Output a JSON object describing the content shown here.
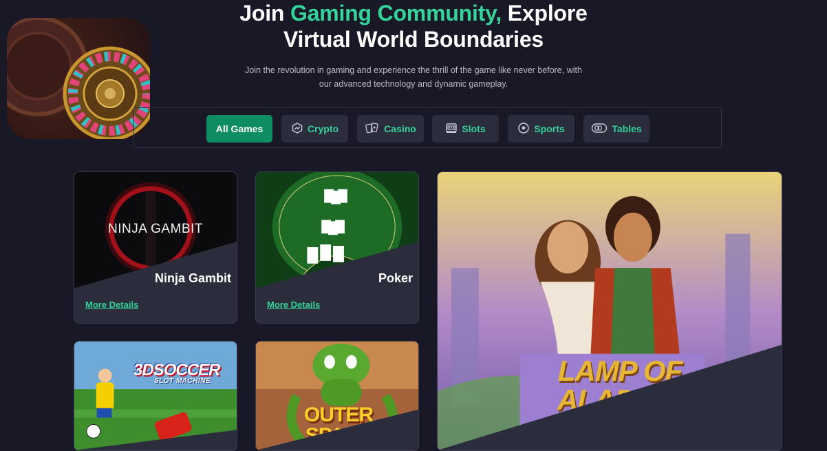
{
  "hero": {
    "title_part1": "Join ",
    "title_accent": "Gaming Community,",
    "title_part2": " Explore",
    "title_line2": "Virtual World Boundaries",
    "subtitle": "Join the revolution in gaming and experience the thrill of the game like never before, with our advanced technology and dynamic gameplay."
  },
  "tabs": [
    {
      "label": "All Games",
      "icon": "",
      "active": true
    },
    {
      "label": "Crypto",
      "icon": "crypto-icon"
    },
    {
      "label": "Casino",
      "icon": "cards-icon"
    },
    {
      "label": "Slots",
      "icon": "slot-machine-icon"
    },
    {
      "label": "Sports",
      "icon": "soccer-ball-icon"
    },
    {
      "label": "Tables",
      "icon": "table-icon"
    }
  ],
  "games": [
    {
      "title": "Ninja Gambit",
      "art_text": "NINJA GAMBIT",
      "link": "More Details"
    },
    {
      "title": "Poker",
      "link": "More Details"
    },
    {
      "art_text_top": "3DSOCCER",
      "art_text_sub": "SLOT MACHINE"
    },
    {
      "art_text": "OUTER SPACE"
    },
    {
      "art_text": "LAMP OF ALADDIN"
    }
  ],
  "colors": {
    "accent": "#34d399",
    "active_tab": "#0e8c62",
    "background": "#181827",
    "card": "#2b2c3c"
  }
}
